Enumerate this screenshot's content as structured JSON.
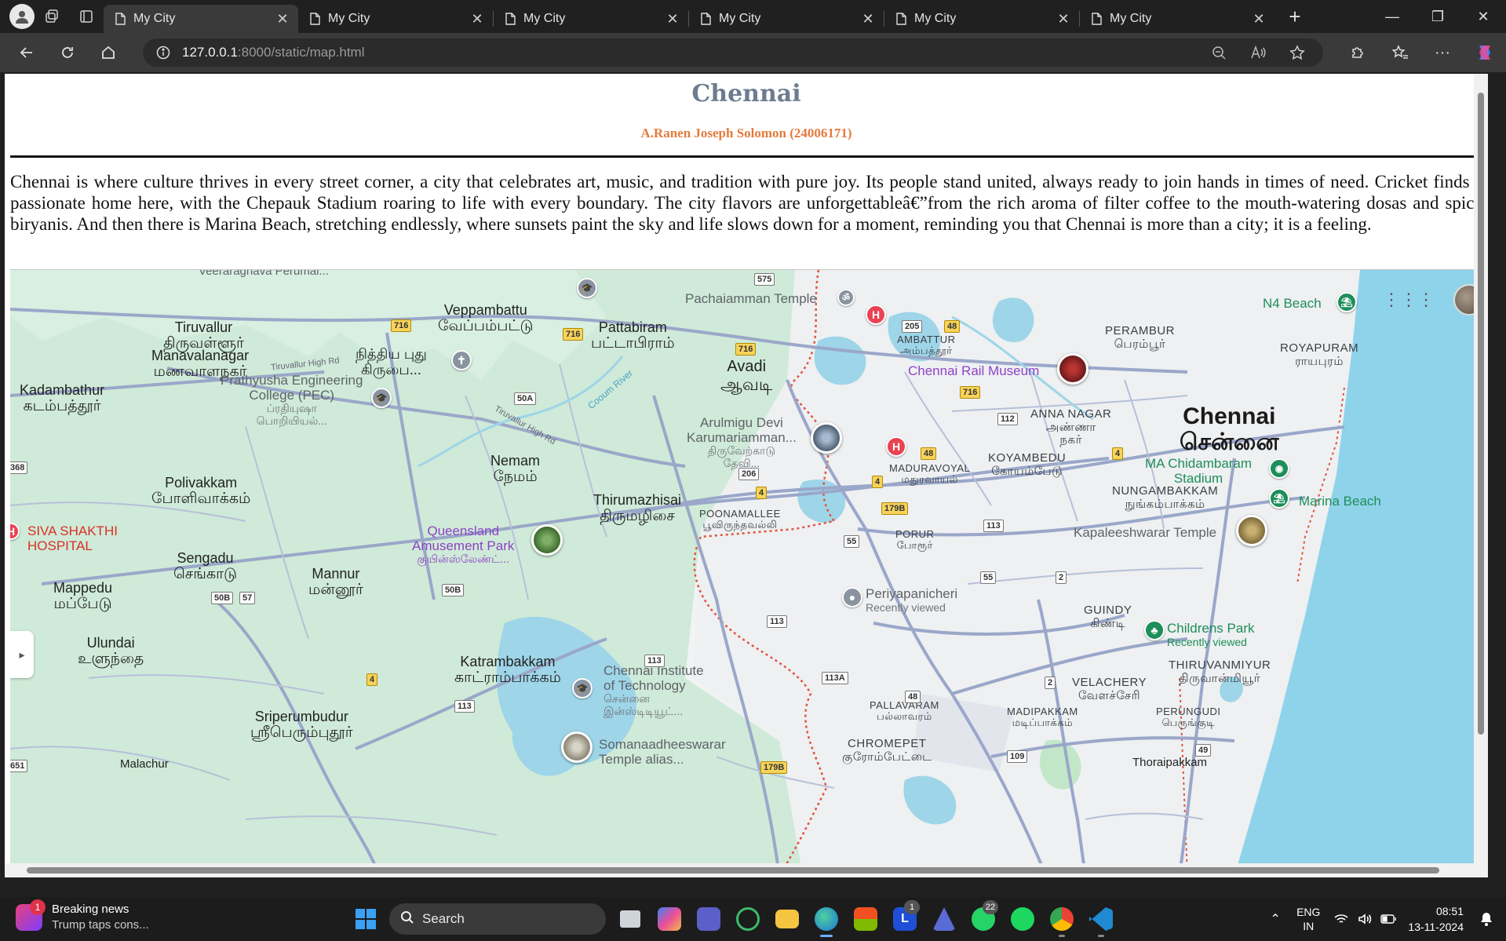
{
  "browser": {
    "tabs": [
      {
        "title": "My City",
        "active": true
      },
      {
        "title": "My City",
        "active": false
      },
      {
        "title": "My City",
        "active": false
      },
      {
        "title": "My City",
        "active": false
      },
      {
        "title": "My City",
        "active": false
      },
      {
        "title": "My City",
        "active": false
      }
    ],
    "new_tab": "+",
    "address": {
      "host": "127.0.0.1",
      "path": ":8000/static/map.html"
    }
  },
  "page": {
    "title": "Chennai",
    "author": "A.Ranen Joseph Solomon (24006171)",
    "paragraph": "Chennai is where culture thrives in every street corner, a city that celebrates art, music, and tradition with pure joy. Its people stand united, always ready to join hands in times of need. Cricket finds a passionate home here, with the Chepauk Stadium roaring to life with every boundary. The city flavors are unforgettableâ€”from the rich aroma of filter coffee to the mouth-watering dosas and spicy biryanis. And then there is Marina Beach, stretching endlessly, where sunsets paint the sky and life slows down for a moment, reminding you that Chennai is more than a city; it is a feeling."
  },
  "map": {
    "places": {
      "veeraraghava": "Veeraraghava Perumal...",
      "tiruvallur": "Tiruvallur",
      "tiruvallur_ta": "திருவள்ளூர்",
      "manavalanagar": "Manavalanagar",
      "manavalanagar_ta": "மணவாளநகர்",
      "kadambathur": "Kadambathur",
      "kadambathur_ta": "கடம்பத்தூர்",
      "veppambattu": "Veppambattu",
      "veppambattu_ta": "வேப்பம்பட்டு",
      "pattabiram": "Pattabiram",
      "pattabiram_ta": "பட்டாபிராம்",
      "nithya": "நித்திய புது",
      "nithya2": "கிருபை...",
      "prathyusha": "Prathyusha Engineering",
      "prathyusha2": "College (PEC)",
      "prathyusha_ta": "ப்ரதியுஷா",
      "prathyusha_ta2": "பொறியியல்...",
      "pachaiamman": "Pachaiamman Temple",
      "ambattur": "AMBATTUR",
      "ambattur_ta": "அம்பத்தூர்",
      "avadi": "Avadi",
      "avadi_ta": "ஆவடி",
      "rail_museum": "Chennai Rail Museum",
      "perambur": "PERAMBUR",
      "perambur_ta": "பெரம்பூர்",
      "royapuram": "ROYAPURAM",
      "royapuram_ta": "ராயபுரம்",
      "n4": "N4 Beach",
      "anna_nagar": "ANNA NAGAR",
      "anna_nagar_ta": "அண்ணா",
      "anna_nagar_ta2": "நகர்",
      "chennai_big": "Chennai",
      "chennai_big_ta": "சென்னை",
      "arulmigu": "Arulmigu Devi",
      "arulmigu2": "Karumariamman...",
      "arulmigu_ta": "திருவேற்காடு",
      "arulmigu_ta2": "தேவி...",
      "maduravoyal": "MADURAVOYAL",
      "maduravoyal_ta": "மதுரவாயல்",
      "koyambedu": "KOYAMBEDU",
      "koyambedu_ta": "கோயம்பேடு",
      "chidambaram": "MA Chidambaram",
      "chidambaram2": "Stadium",
      "nungambakkam": "NUNGAMBAKKAM",
      "nungambakkam_ta": "நுங்கம்பாக்கம்",
      "marina": "Marina Beach",
      "nemam": "Nemam",
      "nemam_ta": "நேமம்",
      "polivakkam": "Polivakkam",
      "polivakkam_ta": "போளிவாக்கம்",
      "thirumazhisai": "Thirumazhisai",
      "thirumazhisai_ta": "திருமழிசை",
      "poonamallee": "POONAMALLEE",
      "poonamallee_ta": "பூவிருந்தவல்லி",
      "siva": "SIVA SHAKTHI",
      "siva2": "HOSPITAL",
      "queensland": "Queensland",
      "queensland2": "Amusement Park",
      "queensland_ta": "குயின்ஸ்லேண்ட்...",
      "kapaleeshwarar": "Kapaleeshwarar Temple",
      "porur": "PORUR",
      "porur_ta": "போரூர்",
      "sengadu": "Sengadu",
      "sengadu_ta": "செங்காடு",
      "mannur": "Mannur",
      "mannur_ta": "மன்னூர்",
      "mappedu": "Mappedu",
      "mappedu_ta": "மப்பேடு",
      "periyapanicheri": "Periyapanicheri",
      "recently_viewed": "Recently viewed",
      "guindy": "GUINDY",
      "guindy_ta": "கிண்டி",
      "childrens_park": "Childrens Park",
      "ulundai": "Ulundai",
      "ulundai_ta": "உளுந்தை",
      "katrambakkam": "Katrambakkam",
      "katrambakkam_ta": "காட்ராம்பாக்கம்",
      "cit": "Chennai Institute",
      "cit2": "of Technology",
      "cit_ta": "சென்னை",
      "cit_ta2": "இன்ஸ்டிடியூட்...",
      "thiruvanmiyur": "THIRUVANMIYUR",
      "thiruvanmiyur_ta": "திருவான்மியூர்",
      "velachery": "VELACHERY",
      "velachery_ta": "வேளச்சேரி",
      "pallavaram": "PALLAVARAM",
      "pallavaram_ta": "பல்லாவரம்",
      "madipakkam": "MADIPAKKAM",
      "madipakkam_ta": "மடிப்பாக்கம்",
      "perungudi": "PERUNGUDI",
      "perungudi_ta": "பெருங்குடி",
      "sriperumbudur": "Sriperumbudur",
      "sriperumbudur_ta": "ஸ்ரீபெரும்புதூர்",
      "somanaadheeswarar": "Somanaadheeswarar",
      "somanaadheeswarar2": "Temple alias...",
      "chromepet": "CHROMEPET",
      "chromepet_ta": "குரோம்பேட்டை",
      "thoraipakkam": "Thoraipakkam",
      "malachur": "Malachur",
      "tiruvallur_hr": "Tiruvallur High Rd",
      "tiruvallur_hr2": "Tiruvallur High Rd",
      "cooum": "Cooum River"
    },
    "roads": [
      "575",
      "716",
      "716",
      "716",
      "205",
      "48",
      "716",
      "112",
      "4",
      "48",
      "4",
      "206",
      "4",
      "179B",
      "113",
      "55",
      "55",
      "2",
      "2",
      "50B",
      "57",
      "50B",
      "113",
      "113",
      "4",
      "113A",
      "48",
      "113",
      "109",
      "49",
      "179B",
      "50A",
      "368",
      "651"
    ]
  },
  "taskbar": {
    "news_title": "Breaking news",
    "news_sub": "Trump taps cons...",
    "news_badge": "1",
    "search_label": "Search",
    "teams_badge": "1",
    "whatsapp_badge": "22",
    "lang1": "ENG",
    "lang2": "IN",
    "time": "08:51",
    "date": "13-11-2024"
  }
}
